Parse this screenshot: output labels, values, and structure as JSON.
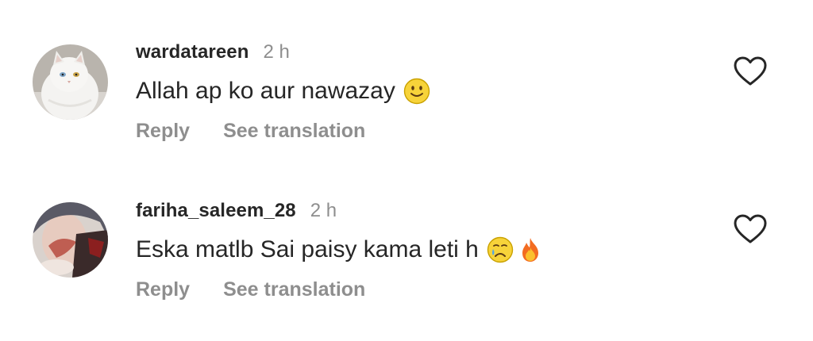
{
  "comments": [
    {
      "username": "wardatareen",
      "time": "2 h",
      "text": "Allah ap ko aur nawazay",
      "emojis": [
        "slightly-smiling-face-emoji"
      ],
      "reply_label": "Reply",
      "translate_label": "See translation",
      "avatar": "white-cat-avatar",
      "like_icon": "heart-outline-icon"
    },
    {
      "username": "fariha_saleem_28",
      "time": "2 h",
      "text": "Eska matlb Sai paisy kama leti h",
      "emojis": [
        "crying-face-emoji",
        "fire-emoji"
      ],
      "reply_label": "Reply",
      "translate_label": "See translation",
      "avatar": "user-photo-avatar",
      "like_icon": "heart-outline-icon"
    }
  ],
  "colors": {
    "text": "#262626",
    "secondary": "#8e8e8e",
    "background": "#ffffff"
  }
}
